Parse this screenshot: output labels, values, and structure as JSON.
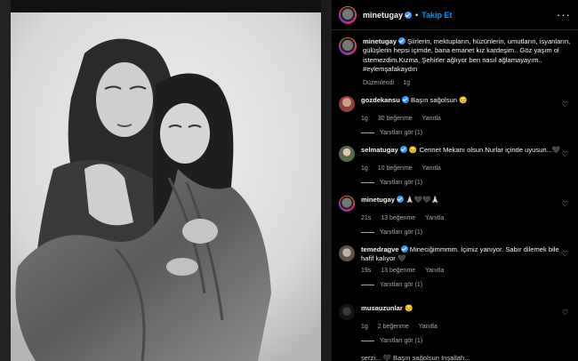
{
  "header": {
    "username": "minetugay",
    "separator": "•",
    "follow_label": "Takip Et",
    "more_icon": "more-horizontal-icon"
  },
  "caption": {
    "username": "minetugay",
    "text": "Şiirlerin, mektupların, hüzünlerin, umutların, isyanların, gülüşlerin hepsi içimde, bana emanet kız kardeşim.. Göz yaşım ol istemezdim.Kızma, Şehirler ağlıyor ben nasıl ağlamayayım.. #eylemşafakaydın",
    "edited": "Düzenlendi",
    "separator": "·",
    "age": "1g"
  },
  "comments": [
    {
      "username": "gozdekansu",
      "text": "Başın sağolsun 😔",
      "age": "1g",
      "likes": "30 beğenme",
      "reply": "Yanıtla",
      "view_replies": "Yanıtları gör (1)",
      "verified": true
    },
    {
      "username": "selmatugay",
      "text": "😔 Cennet Mekanı olsun.Nurlar içinde uyusun...🖤",
      "age": "1g",
      "likes": "10 beğenme",
      "reply": "Yanıtla",
      "view_replies": "Yanıtları gör (1)",
      "verified": true
    },
    {
      "username": "minetugay",
      "text": "🙏🏻🖤🖤🙏🏻",
      "age": "21s",
      "likes": "13 beğenme",
      "reply": "Yanıtla",
      "view_replies": "Yanıtları gör (1)",
      "verified": true
    },
    {
      "username": "temedragve",
      "text": "Mineciğimmmm. İçimiz yanıyor. Sabır dilemek bile hafif kalıyor 🖤",
      "age": "19s",
      "likes": "13 beğenme",
      "reply": "Yanıtla",
      "view_replies": "Yanıtları gör (1)",
      "verified": true
    },
    {
      "username": "musauzunlar",
      "text": "😔",
      "age": "1g",
      "likes": "2 beğenme",
      "reply": "Yanıtla",
      "view_replies": "Yanıtları gör (1)",
      "verified": false
    }
  ],
  "partial_comment": "serzi... 🖤 Başın sağolsun Inşallah...",
  "icons": {
    "like": "heart-icon",
    "verified": "verified-badge-icon"
  }
}
